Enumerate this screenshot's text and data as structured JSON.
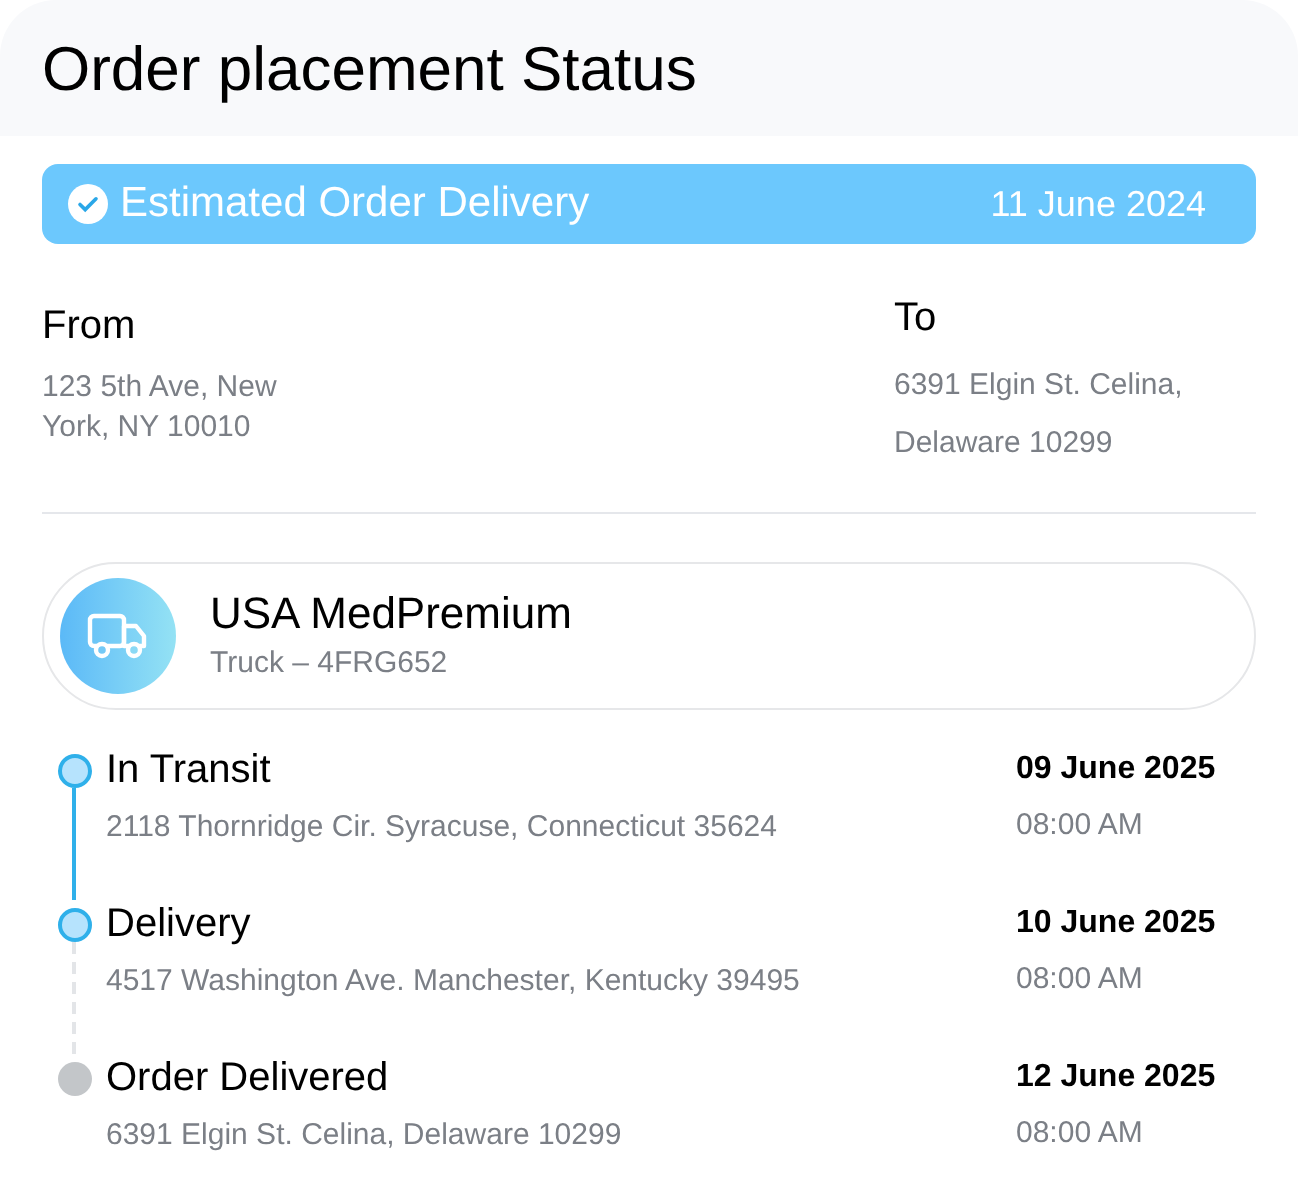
{
  "title": "Order placement Status",
  "estimate": {
    "label": "Estimated Order Delivery",
    "date": "11 June 2024",
    "checked": true
  },
  "from": {
    "label": "From",
    "address": "123 5th Ave, New York, NY 10010"
  },
  "to": {
    "label": "To",
    "address": "6391 Elgin St. Celina, Delaware 10299"
  },
  "carrier": {
    "name": "USA MedPremium",
    "vehicle": "Truck – 4FRG652"
  },
  "steps": [
    {
      "title": "In Transit",
      "address": "2118 Thornridge Cir. Syracuse, Connecticut 35624",
      "date": "09 June 2025",
      "time": "08:00 AM",
      "done": true
    },
    {
      "title": "Delivery",
      "address": "4517 Washington Ave. Manchester, Kentucky 39495",
      "date": "10 June 2025",
      "time": "08:00 AM",
      "done": true
    },
    {
      "title": "Order Delivered",
      "address": "6391 Elgin St. Celina, Delaware 10299",
      "date": "12 June 2025",
      "time": "08:00 AM",
      "done": false
    }
  ]
}
